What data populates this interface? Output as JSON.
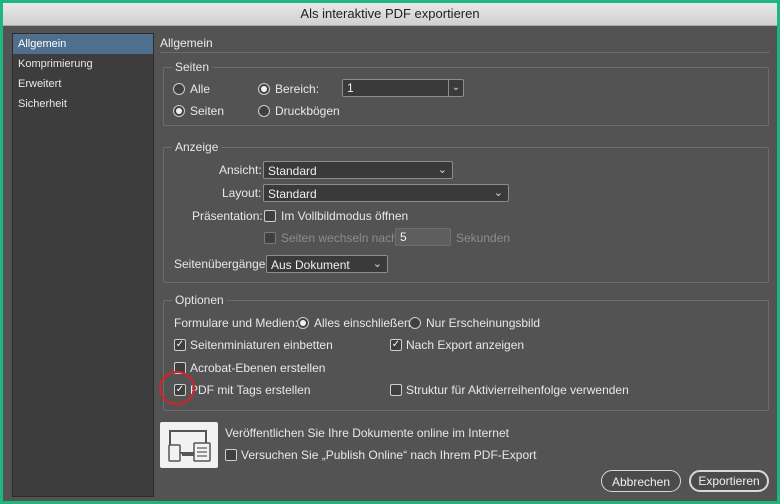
{
  "window": {
    "title": "Als interaktive PDF exportieren"
  },
  "sidebar": {
    "items": [
      {
        "label": "Allgemein",
        "selected": true
      },
      {
        "label": "Komprimierung"
      },
      {
        "label": "Erweitert"
      },
      {
        "label": "Sicherheit"
      }
    ]
  },
  "main": {
    "heading": "Allgemein"
  },
  "seiten": {
    "legend": "Seiten",
    "alle_label": "Alle",
    "bereich_label": "Bereich:",
    "bereich_value": "1",
    "seiten_label": "Seiten",
    "druckboegen_label": "Druckbögen",
    "selected_scope": "Bereich",
    "selected_mode": "Seiten"
  },
  "anzeige": {
    "legend": "Anzeige",
    "ansicht_label": "Ansicht:",
    "ansicht_value": "Standard",
    "layout_label": "Layout:",
    "layout_value": "Standard",
    "praesentation_label": "Präsentation:",
    "vollbild_label": "Im Vollbildmodus öffnen",
    "seiten_wechseln_label": "Seiten wechseln nach:",
    "seiten_wechseln_value": "5",
    "sekunden_label": "Sekunden",
    "seitenuebergaenge_label": "Seitenübergänge:",
    "seitenuebergaenge_value": "Aus Dokument"
  },
  "optionen": {
    "legend": "Optionen",
    "formulare_label": "Formulare und Medien:",
    "alles_label": "Alles einschließen",
    "nur_label": "Nur Erscheinungsbild",
    "miniaturen_label": "Seitenminiaturen einbetten",
    "nach_export_label": "Nach Export anzeigen",
    "acrobat_label": "Acrobat-Ebenen erstellen",
    "tags_label": "PDF mit Tags erstellen",
    "struktur_label": "Struktur für Aktivierreihenfolge verwenden"
  },
  "publish": {
    "text": "Veröffentlichen Sie Ihre Dokumente online im Internet",
    "checkbox_label": "Versuchen Sie „Publish Online“ nach Ihrem PDF-Export"
  },
  "buttons": {
    "cancel": "Abbrechen",
    "export": "Exportieren"
  },
  "icons": {
    "check": "✓",
    "chevron": "⌄"
  }
}
